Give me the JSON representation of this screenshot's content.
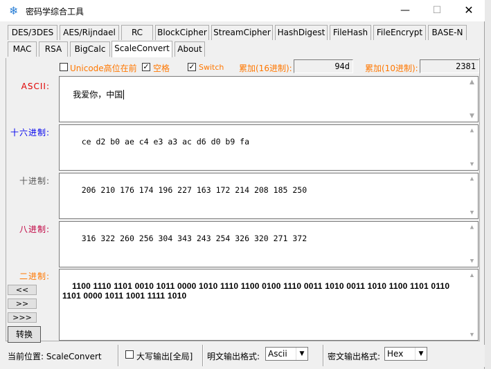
{
  "window": {
    "title": "密码学综合工具",
    "min_glyph": "—",
    "max_glyph": "☐",
    "close_glyph": "✕"
  },
  "tabs_row1": [
    "DES/3DES",
    "AES/Rijndael",
    "RC",
    "BlockCipher",
    "StreamCipher",
    "HashDigest",
    "FileHash",
    "FileEncrypt",
    "BASE-N"
  ],
  "tabs_row2": [
    "MAC",
    "RSA",
    "BigCalc",
    "ScaleConvert",
    "About"
  ],
  "active_tab": "ScaleConvert",
  "options": {
    "unicode_high_first": {
      "label": "Unicode高位在前",
      "checked": false
    },
    "space": {
      "label": "空格",
      "checked": true
    },
    "switch": {
      "label": "Switch",
      "checked": true
    },
    "sum_hex_label": "累加(16进制):",
    "sum_hex_value": "94d",
    "sum_dec_label": "累加(10进制):",
    "sum_dec_value": "2381"
  },
  "fields": {
    "ascii": {
      "label": "ASCII:",
      "value": "我爱你，中国"
    },
    "hex": {
      "label": "十六进制:",
      "value": "ce d2 b0 ae c4 e3 a3 ac d6 d0 b9 fa"
    },
    "dec": {
      "label": "十进制:",
      "value": "206 210 176 174 196 227 163 172 214 208 185 250"
    },
    "oct": {
      "label": "八进制:",
      "value": "316 322 260 256 304 343 243 254 326 320 271 372"
    },
    "bin": {
      "label": "二进制:",
      "value": "1100 1110 1101 0010 1011 0000 1010 1110 1100 0100 1110 0011 1010 0011 1010 1100 1101 0110 1101 0000 1011 1001 1111 1010"
    }
  },
  "nav_buttons": [
    "<<",
    ">>",
    ">>>"
  ],
  "convert_label": "转换",
  "status": {
    "current_position": "当前位置: ScaleConvert",
    "uppercase_label": "大写输出[全局]",
    "uppercase_checked": false,
    "plain_format_label": "明文输出格式:",
    "plain_format_value": "Ascii",
    "cipher_format_label": "密文输出格式:",
    "cipher_format_value": "Hex"
  },
  "colors": {
    "orange": "#ff7700",
    "red": "#e00000",
    "blue": "#0000ee"
  }
}
